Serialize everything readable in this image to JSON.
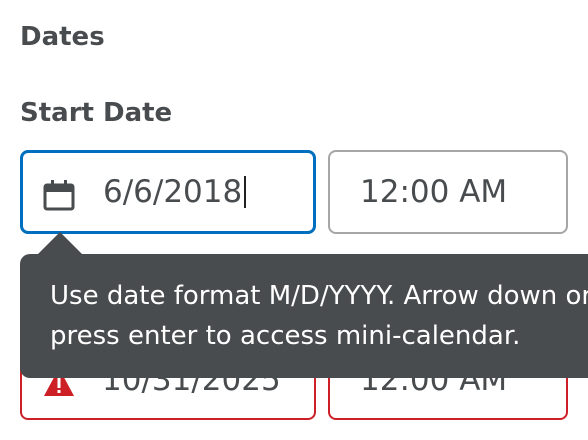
{
  "section": {
    "heading": "Dates"
  },
  "start": {
    "label": "Start Date",
    "date_value": "6/6/2018",
    "time_value": "12:00 AM"
  },
  "end": {
    "date_value": "10/31/2025",
    "time_value": "12:00 AM"
  },
  "tooltip": {
    "line1": "Use date format M/D/YYYY. Arrow down or",
    "line2": "press enter to access mini-calendar."
  },
  "colors": {
    "focus_border": "#006fbf",
    "error_border": "#cd2026",
    "tooltip_bg": "#494c4e",
    "text": "#494c4e"
  },
  "icons": {
    "date": "calendar-icon",
    "error": "warning-icon"
  }
}
